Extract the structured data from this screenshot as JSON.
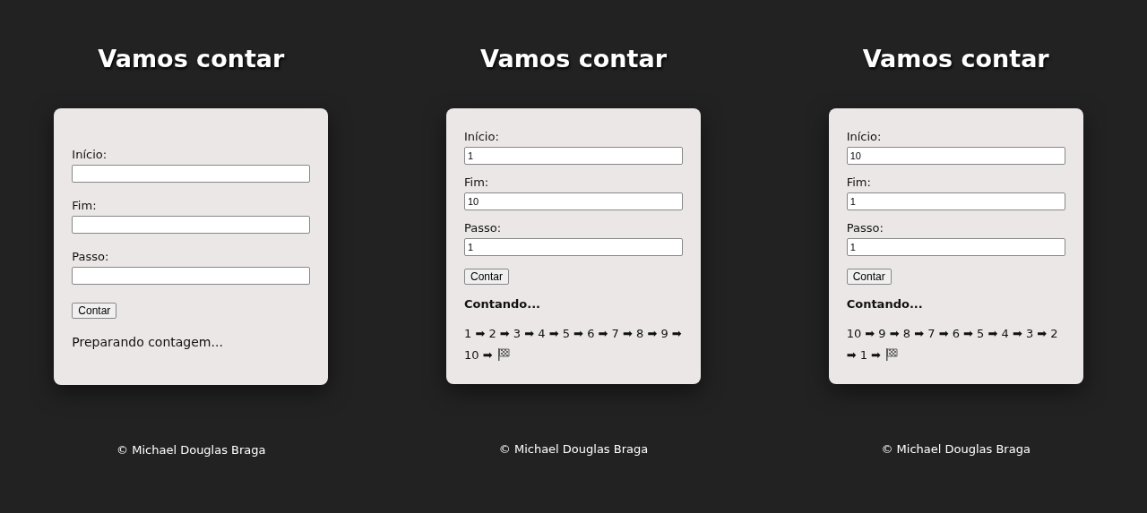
{
  "panels": [
    {
      "title": "Vamos contar",
      "fields": [
        {
          "label": "Início:"
        },
        {
          "label": "Fim:"
        },
        {
          "label": "Passo:"
        }
      ],
      "button": "Contar",
      "status": {
        "text": "Preparando contagem...",
        "kind": "plain"
      },
      "footer": "© Michael Douglas Braga"
    },
    {
      "title": "Vamos contar",
      "fields": [
        {
          "label": "Início:",
          "value": "1"
        },
        {
          "label": "Fim:",
          "value": "10"
        },
        {
          "label": "Passo:",
          "value": "1"
        }
      ],
      "button": "Contar",
      "status": {
        "text": "Contando...",
        "kind": "heading"
      },
      "result": {
        "text": "1 ➡ 2 ➡ 3 ➡ 4 ➡ 5 ➡ 6 ➡ 7 ➡ 8 ➡ 9 ➡ 10 ➡",
        "end_flag": true
      },
      "footer": "© Michael Douglas Braga"
    },
    {
      "title": "Vamos contar",
      "fields": [
        {
          "label": "Início:",
          "value": "10"
        },
        {
          "label": "Fim:",
          "value": "1"
        },
        {
          "label": "Passo:",
          "value": "1"
        }
      ],
      "button": "Contar",
      "status": {
        "text": "Contando...",
        "kind": "heading"
      },
      "result": {
        "text": "10 ➡ 9 ➡ 8 ➡ 7 ➡ 6 ➡ 5 ➡ 4 ➡ 3 ➡ 2 ➡ 1 ➡",
        "end_flag": true
      },
      "footer": "© Michael Douglas Braga"
    }
  ]
}
